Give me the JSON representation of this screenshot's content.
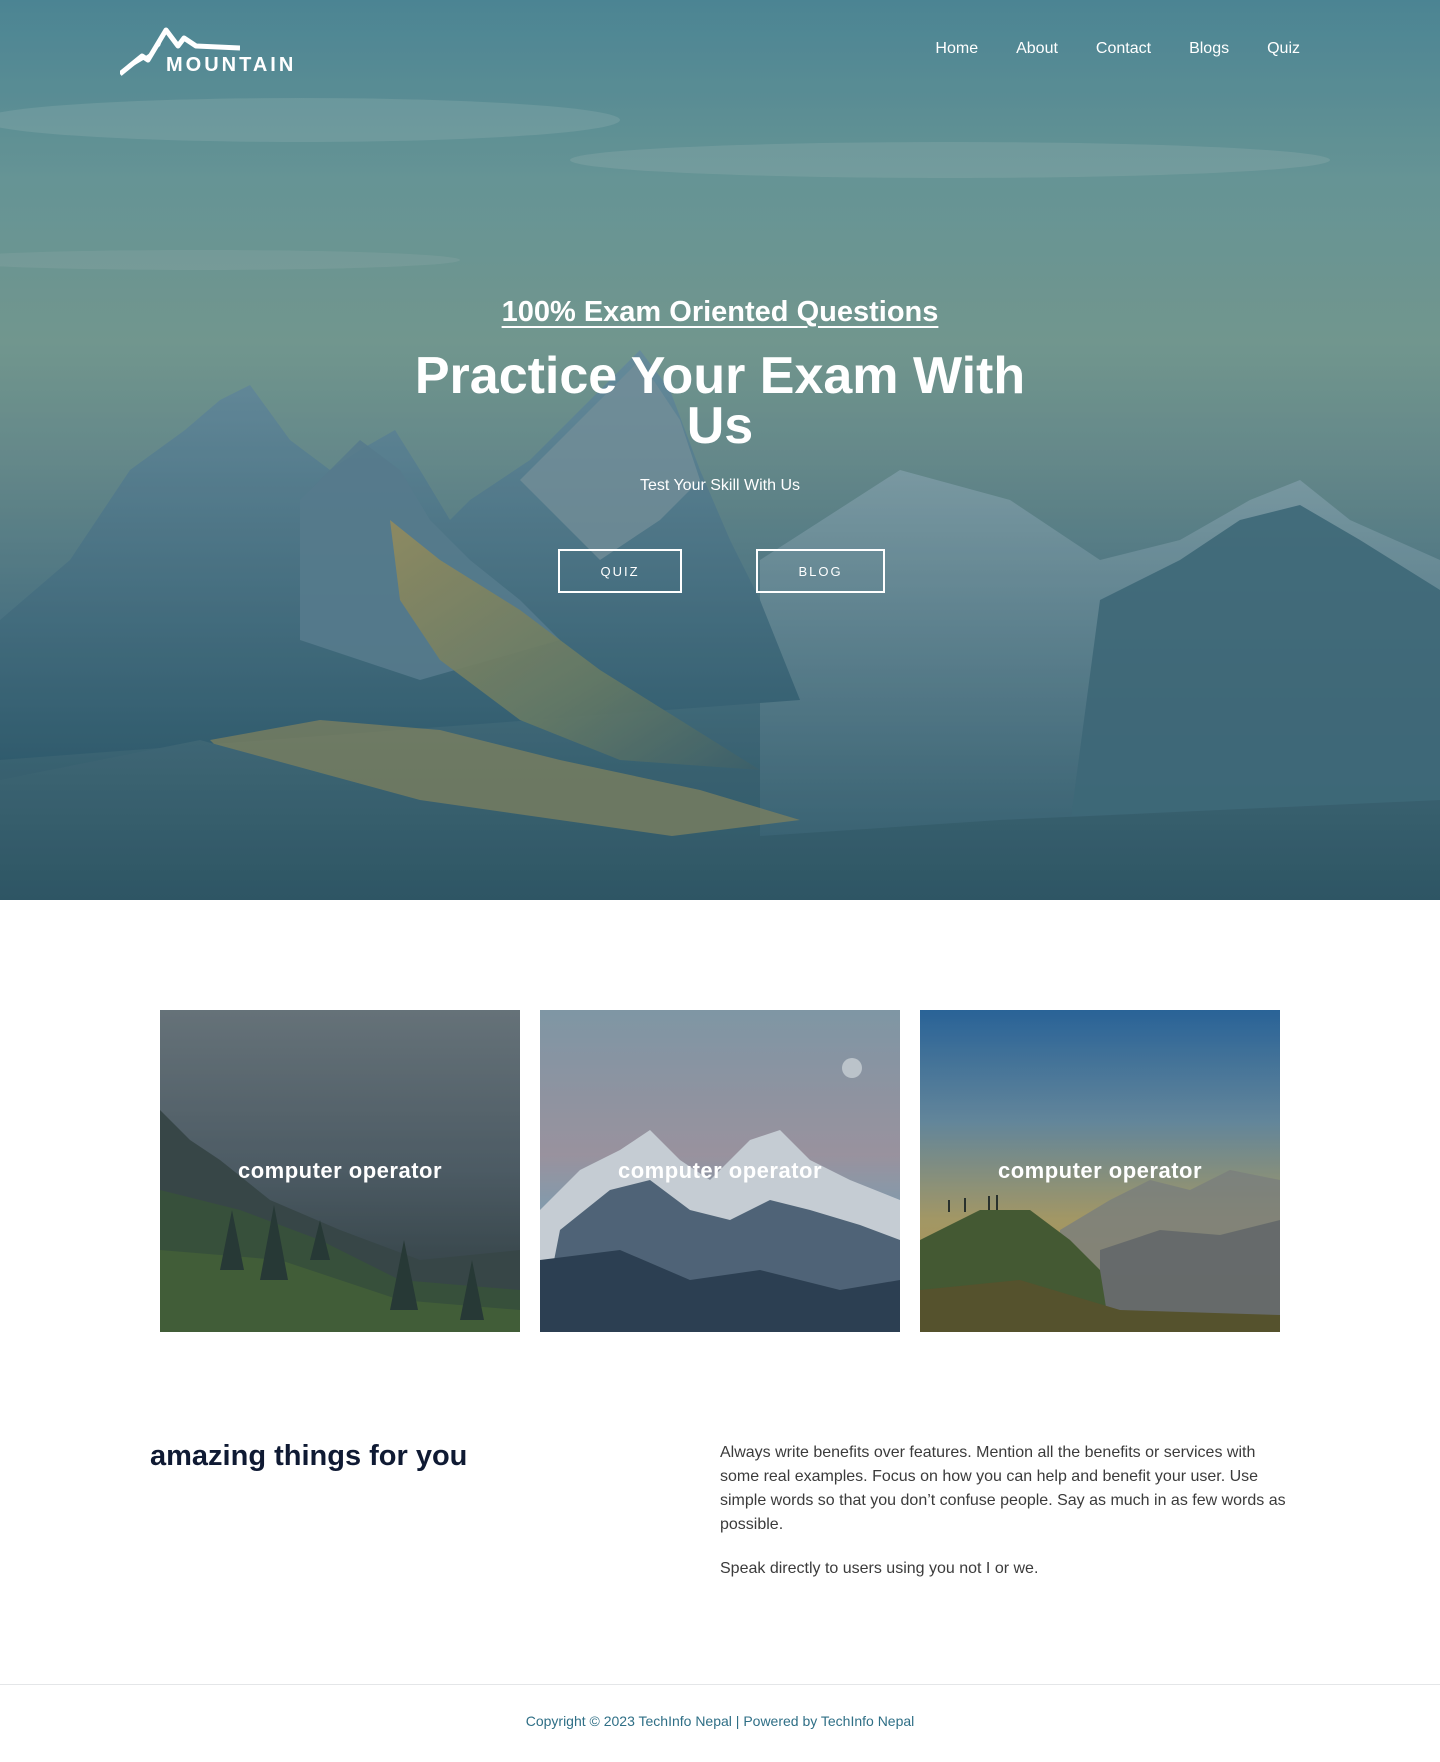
{
  "brand": {
    "logo_text": "MOUNTAIN"
  },
  "nav": {
    "items": [
      {
        "label": "Home"
      },
      {
        "label": "About"
      },
      {
        "label": "Contact"
      },
      {
        "label": "Blogs"
      },
      {
        "label": "Quiz"
      }
    ]
  },
  "hero": {
    "eyebrow": "100% Exam Oriented Questions",
    "headline": "Practice Your Exam With Us",
    "subline": "Test Your Skill With Us",
    "buttons": {
      "quiz": "QUIZ",
      "blog": "BLOG"
    }
  },
  "cards": [
    {
      "title": "computer operator"
    },
    {
      "title": "computer operator"
    },
    {
      "title": "computer operator"
    }
  ],
  "feature": {
    "heading": "amazing things for you",
    "paragraphs": [
      "Always write benefits over features. Mention all the benefits or services with some real examples. Focus on how you can help and benefit your user. Use simple words so that you don’t confuse people. Say as much in as few words as possible.",
      "Speak directly to users using you not I or we."
    ]
  },
  "footer": {
    "copyright": "Copyright © 2023 TechInfo Nepal | Powered by TechInfo Nepal"
  },
  "colors": {
    "heading_dark": "#0f1a33",
    "footer_link": "#2f6f86",
    "hero_overlay": "#4f8795"
  }
}
